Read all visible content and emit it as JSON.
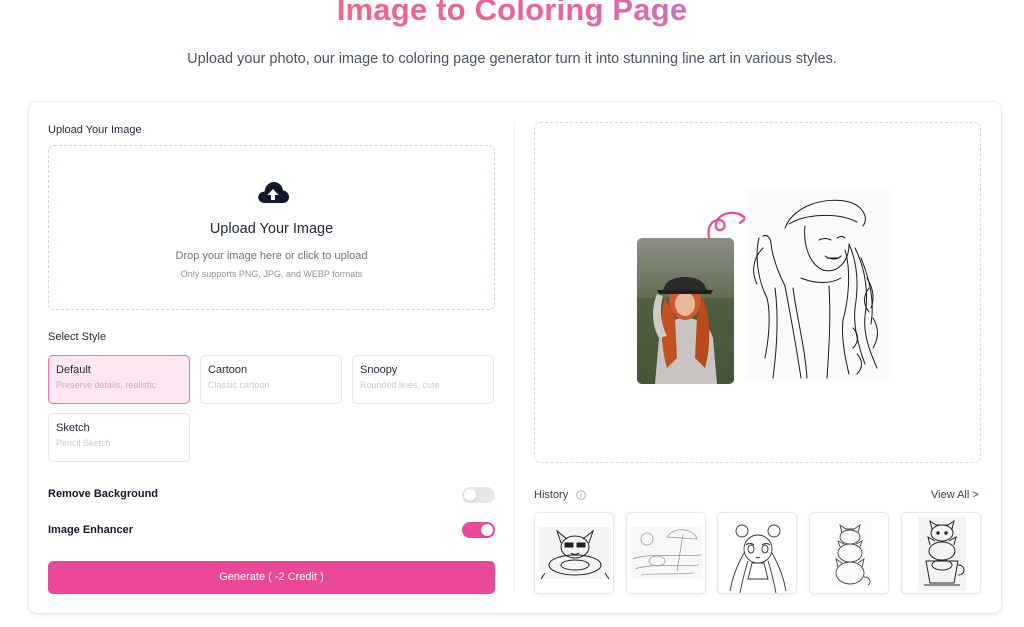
{
  "header": {
    "title": "Image to Coloring Page",
    "subtitle": "Upload your photo, our image to coloring page generator turn it into stunning line art in various styles."
  },
  "upload": {
    "section_label": "Upload Your Image",
    "icon": "cloud-upload-icon",
    "title": "Upload Your Image",
    "hint": "Drop your image here or click to upload",
    "formats": "Only supports PNG, JPG, and WEBP formats"
  },
  "styles": {
    "section_label": "Select Style",
    "selected": "Default",
    "items": [
      {
        "name": "Default",
        "desc": "Preserve details, realistic"
      },
      {
        "name": "Cartoon",
        "desc": "Classic cartoon"
      },
      {
        "name": "Snoopy",
        "desc": "Rounded lines, cute"
      },
      {
        "name": "Sketch",
        "desc": "Pencil Sketch"
      }
    ]
  },
  "options": {
    "remove_background": {
      "label": "Remove Background",
      "enabled": false
    },
    "image_enhancer": {
      "label": "Image Enhancer",
      "enabled": true
    }
  },
  "generate": {
    "label": "Generate ( -2 Credit )"
  },
  "history": {
    "label": "History",
    "view_all": "View All >",
    "thumbnails": [
      "shiba-dog-sketch",
      "beach-umbrella-sketch",
      "anime-girl-sketch",
      "stacked-cats-sketch",
      "cats-in-cup-sketch"
    ]
  },
  "colors": {
    "accent": "#ec4899",
    "selected_bg": "#fce7f3",
    "title_gradient": [
      "#f07a5a",
      "#ef5f9a",
      "#9c8cf2"
    ]
  }
}
